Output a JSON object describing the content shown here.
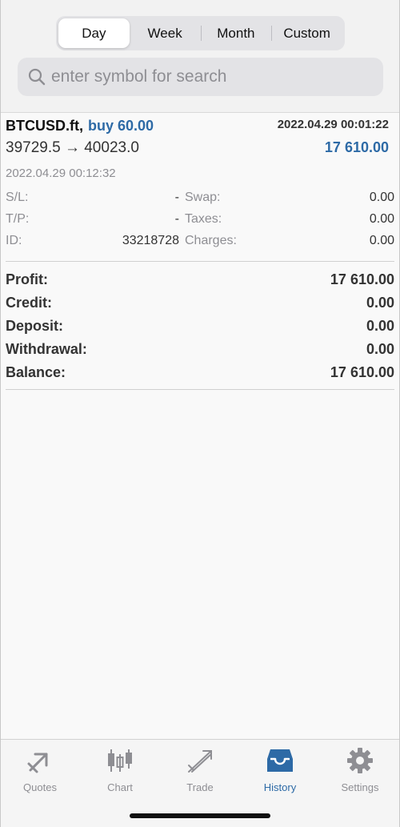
{
  "period_tabs": [
    "Day",
    "Week",
    "Month",
    "Custom"
  ],
  "search": {
    "placeholder": "enter symbol for search"
  },
  "deal": {
    "symbol": "BTCUSD.ft,",
    "action": "buy 60.00",
    "open_time": "2022.04.29 00:01:22",
    "prices": "39729.5 → 40023.0",
    "profit": "17 610.00",
    "close_time": "2022.04.29 00:12:32",
    "details": {
      "sl_label": "S/L:",
      "sl_value": "-",
      "tp_label": "T/P:",
      "tp_value": "-",
      "id_label": "ID:",
      "id_value": "33218728",
      "swap_label": "Swap:",
      "swap_value": "0.00",
      "taxes_label": "Taxes:",
      "taxes_value": "0.00",
      "charges_label": "Charges:",
      "charges_value": "0.00"
    }
  },
  "summary": [
    {
      "label": "Profit:",
      "value": "17 610.00"
    },
    {
      "label": "Credit:",
      "value": "0.00"
    },
    {
      "label": "Deposit:",
      "value": "0.00"
    },
    {
      "label": "Withdrawal:",
      "value": "0.00"
    },
    {
      "label": "Balance:",
      "value": "17 610.00"
    }
  ],
  "tabbar": [
    {
      "label": "Quotes",
      "icon": "quotes-icon"
    },
    {
      "label": "Chart",
      "icon": "chart-icon"
    },
    {
      "label": "Trade",
      "icon": "trade-icon"
    },
    {
      "label": "History",
      "icon": "history-icon"
    },
    {
      "label": "Settings",
      "icon": "settings-icon"
    }
  ],
  "colors": {
    "accent": "#2d6aa6",
    "icon_gray": "#8e8e93"
  }
}
